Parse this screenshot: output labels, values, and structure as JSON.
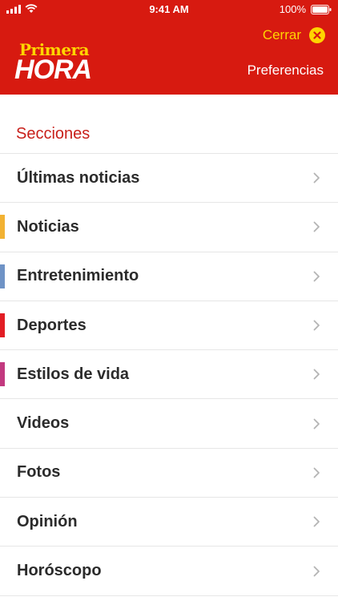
{
  "status_bar": {
    "time": "9:41 AM",
    "battery": "100%"
  },
  "header": {
    "logo_top": "Primera",
    "logo_bottom": "HORA",
    "close_label": "Cerrar",
    "preferences_label": "Preferencias"
  },
  "section_title": "Secciones",
  "menu": {
    "items": [
      {
        "label": "Últimas noticias",
        "accent": ""
      },
      {
        "label": "Noticias",
        "accent": "#f2b233"
      },
      {
        "label": "Entretenimiento",
        "accent": "#6f93c6"
      },
      {
        "label": "Deportes",
        "accent": "#e21d24"
      },
      {
        "label": "Estilos de vida",
        "accent": "#c2397f"
      },
      {
        "label": "Videos",
        "accent": ""
      },
      {
        "label": "Fotos",
        "accent": ""
      },
      {
        "label": "Opinión",
        "accent": ""
      },
      {
        "label": "Horóscopo",
        "accent": ""
      }
    ]
  },
  "colors": {
    "header_bg": "#d71a10",
    "brand_yellow": "#ffd500",
    "section_red": "#c8201b"
  },
  "icons": [
    "signal-icon",
    "wifi-icon",
    "battery-icon",
    "close-circle-icon",
    "chevron-right-icon"
  ]
}
